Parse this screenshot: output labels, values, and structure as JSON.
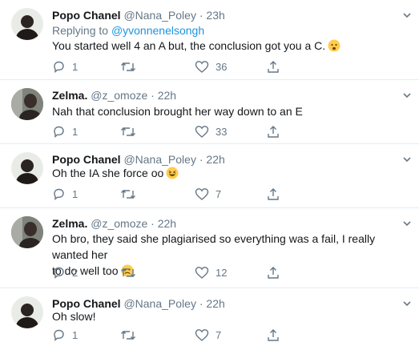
{
  "tweets": [
    {
      "name": "Popo Chanel",
      "handle": "@Nana_Poley",
      "sep": "·",
      "time": "23h",
      "replying_prefix": "Replying to",
      "replying_handle": "@yvonnenelsongh",
      "text": "You started well 4 an A but, the conclusion got you a C.",
      "emoji": "worried-face",
      "replies": "1",
      "retweets": "",
      "likes": "36"
    },
    {
      "name": "Zelma.",
      "handle": "@z_omoze",
      "sep": "·",
      "time": "22h",
      "text": "Nah that conclusion brought her way down to an E",
      "replies": "1",
      "retweets": "",
      "likes": "33"
    },
    {
      "name": "Popo Chanel",
      "handle": "@Nana_Poley",
      "sep": "·",
      "time": "22h",
      "text": "Oh the IA she force oo",
      "emoji": "grinning-squinting-face",
      "replies": "1",
      "retweets": "",
      "likes": "7"
    },
    {
      "name": "Zelma.",
      "handle": "@z_omoze",
      "sep": "·",
      "time": "22h",
      "text_line1": "Oh bro, they said she plagiarised so everything was a fail, I really wanted her",
      "text_line2": "to do well too",
      "emoji": "frowning-face",
      "replies": "2",
      "retweets": "",
      "likes": "12"
    },
    {
      "name": "Popo Chanel",
      "handle": "@Nana_Poley",
      "sep": "·",
      "time": "22h",
      "text": "Oh slow!",
      "replies": "1",
      "retweets": "",
      "likes": "7"
    }
  ],
  "icons": {
    "reply": "reply-icon",
    "retweet": "retweet-icon",
    "like": "heart-icon",
    "share": "share-icon",
    "more": "chevron-down-icon"
  },
  "colors": {
    "link": "#1b95e0",
    "secondary": "#657786",
    "divider": "#e6ecf0"
  }
}
